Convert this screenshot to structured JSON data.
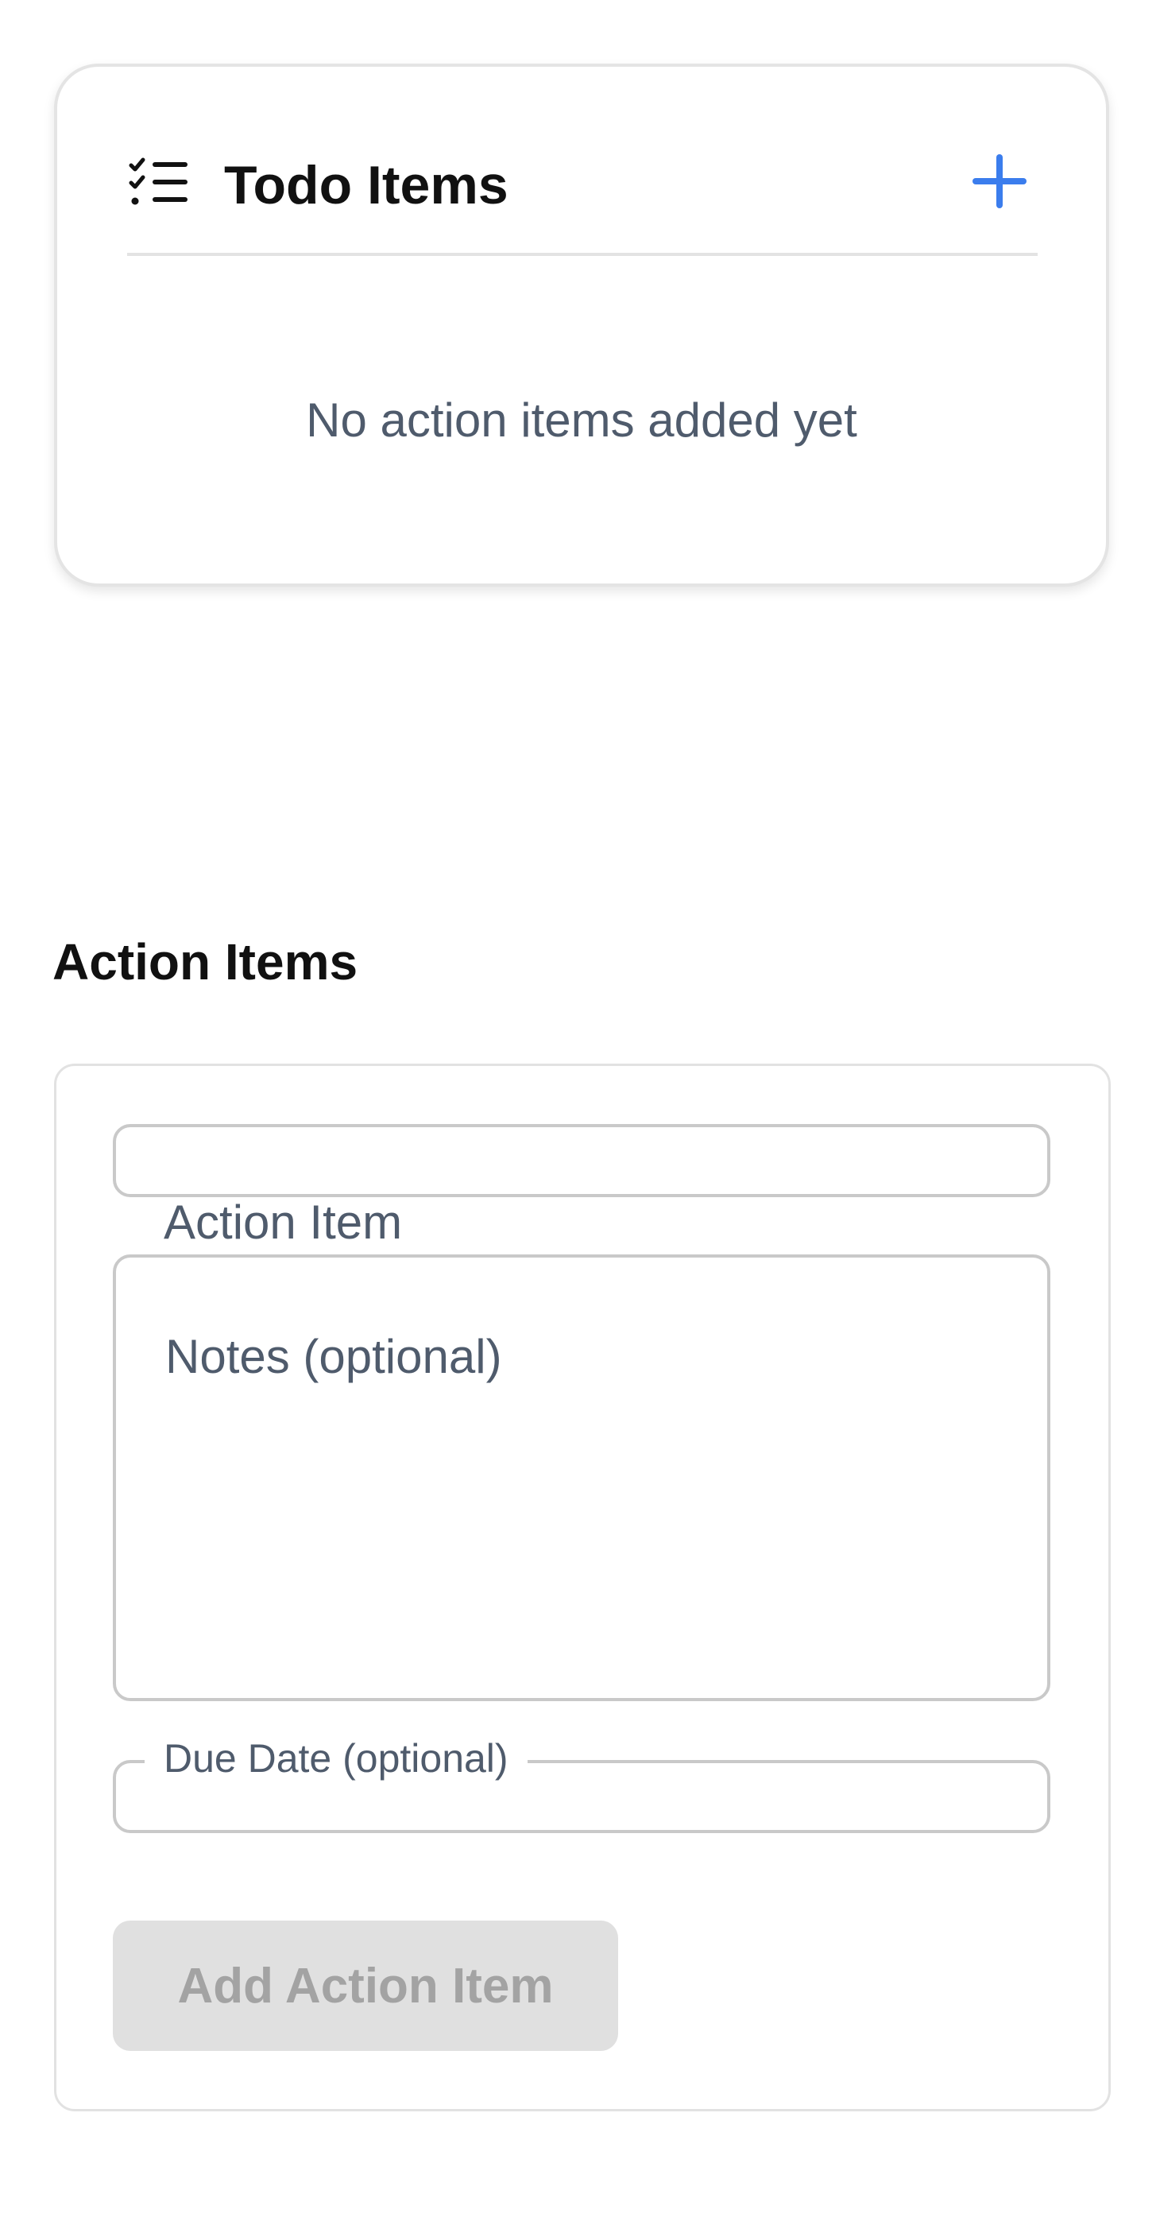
{
  "todo_card": {
    "title": "Todo Items",
    "empty_message": "No action items added yet",
    "icons": {
      "title_icon": "checklist-icon",
      "add_icon": "plus-icon"
    },
    "accent_color": "#3b7ded"
  },
  "action_items": {
    "section_title": "Action Items",
    "action_field": {
      "label": "Action Item",
      "value": ""
    },
    "notes_field": {
      "placeholder": "Notes (optional)",
      "value": ""
    },
    "due_date_field": {
      "label": "Due Date (optional)",
      "value": ""
    },
    "submit_button": {
      "label": "Add Action Item",
      "disabled": true
    }
  }
}
